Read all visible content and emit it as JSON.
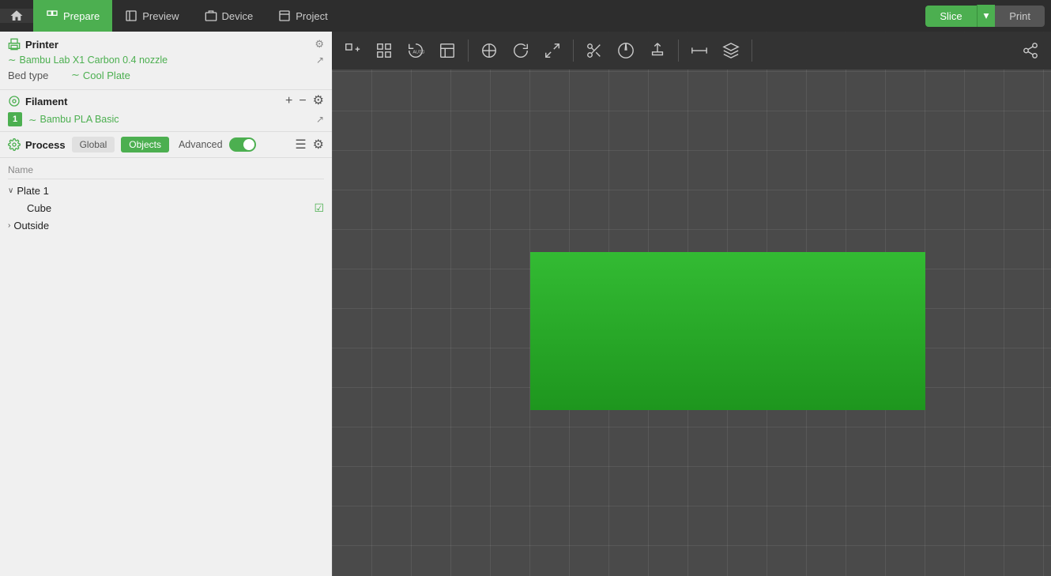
{
  "nav": {
    "home_icon": "⌂",
    "items": [
      {
        "label": "Prepare",
        "active": true,
        "icon": "◻"
      },
      {
        "label": "Preview",
        "active": false,
        "icon": "◫"
      },
      {
        "label": "Device",
        "active": false,
        "icon": "⊞"
      },
      {
        "label": "Project",
        "active": false,
        "icon": "◱"
      }
    ],
    "slice_label": "Slice",
    "print_label": "Print",
    "dropdown_icon": "▾"
  },
  "printer": {
    "section_label": "Printer",
    "printer_name": "Bambu Lab X1 Carbon 0.4 nozzle",
    "bed_type_label": "Bed type",
    "bed_type_value": "Cool Plate"
  },
  "filament": {
    "section_label": "Filament",
    "add_icon": "+",
    "remove_icon": "−",
    "gear_icon": "⚙",
    "items": [
      {
        "num": "1",
        "name": "Bambu PLA Basic"
      }
    ]
  },
  "process": {
    "section_label": "Process",
    "tab_global": "Global",
    "tab_objects": "Objects",
    "advanced_label": "Advanced",
    "toggle_on": true,
    "list_icon": "☰",
    "settings_icon": "⚙"
  },
  "objects": {
    "name_header": "Name",
    "items": [
      {
        "label": "Plate 1",
        "level": 0,
        "has_chevron": true,
        "chevron": "∨",
        "has_checkbox": false
      },
      {
        "label": "Cube",
        "level": 1,
        "has_chevron": false,
        "chevron": "",
        "has_checkbox": true
      },
      {
        "label": "Outside",
        "level": 0,
        "has_chevron": true,
        "chevron": "›",
        "has_checkbox": false
      }
    ]
  },
  "toolbar": {
    "buttons": [
      "⊞",
      "⊞",
      "⟳",
      "▦",
      "⟐",
      "⟐",
      "⬟",
      "⬟",
      "◑",
      "⟡",
      "⬡",
      "⟰",
      "⟰",
      "☇",
      "☇",
      "⊠"
    ]
  },
  "colors": {
    "green": "#4caf50",
    "dark_green": "#388e3c",
    "cube_main": "#2db82d",
    "cube_dark": "#1a8c1a",
    "bg": "#4a4a4a",
    "panel": "#f0f0f0",
    "nav": "#2d2d2d"
  }
}
